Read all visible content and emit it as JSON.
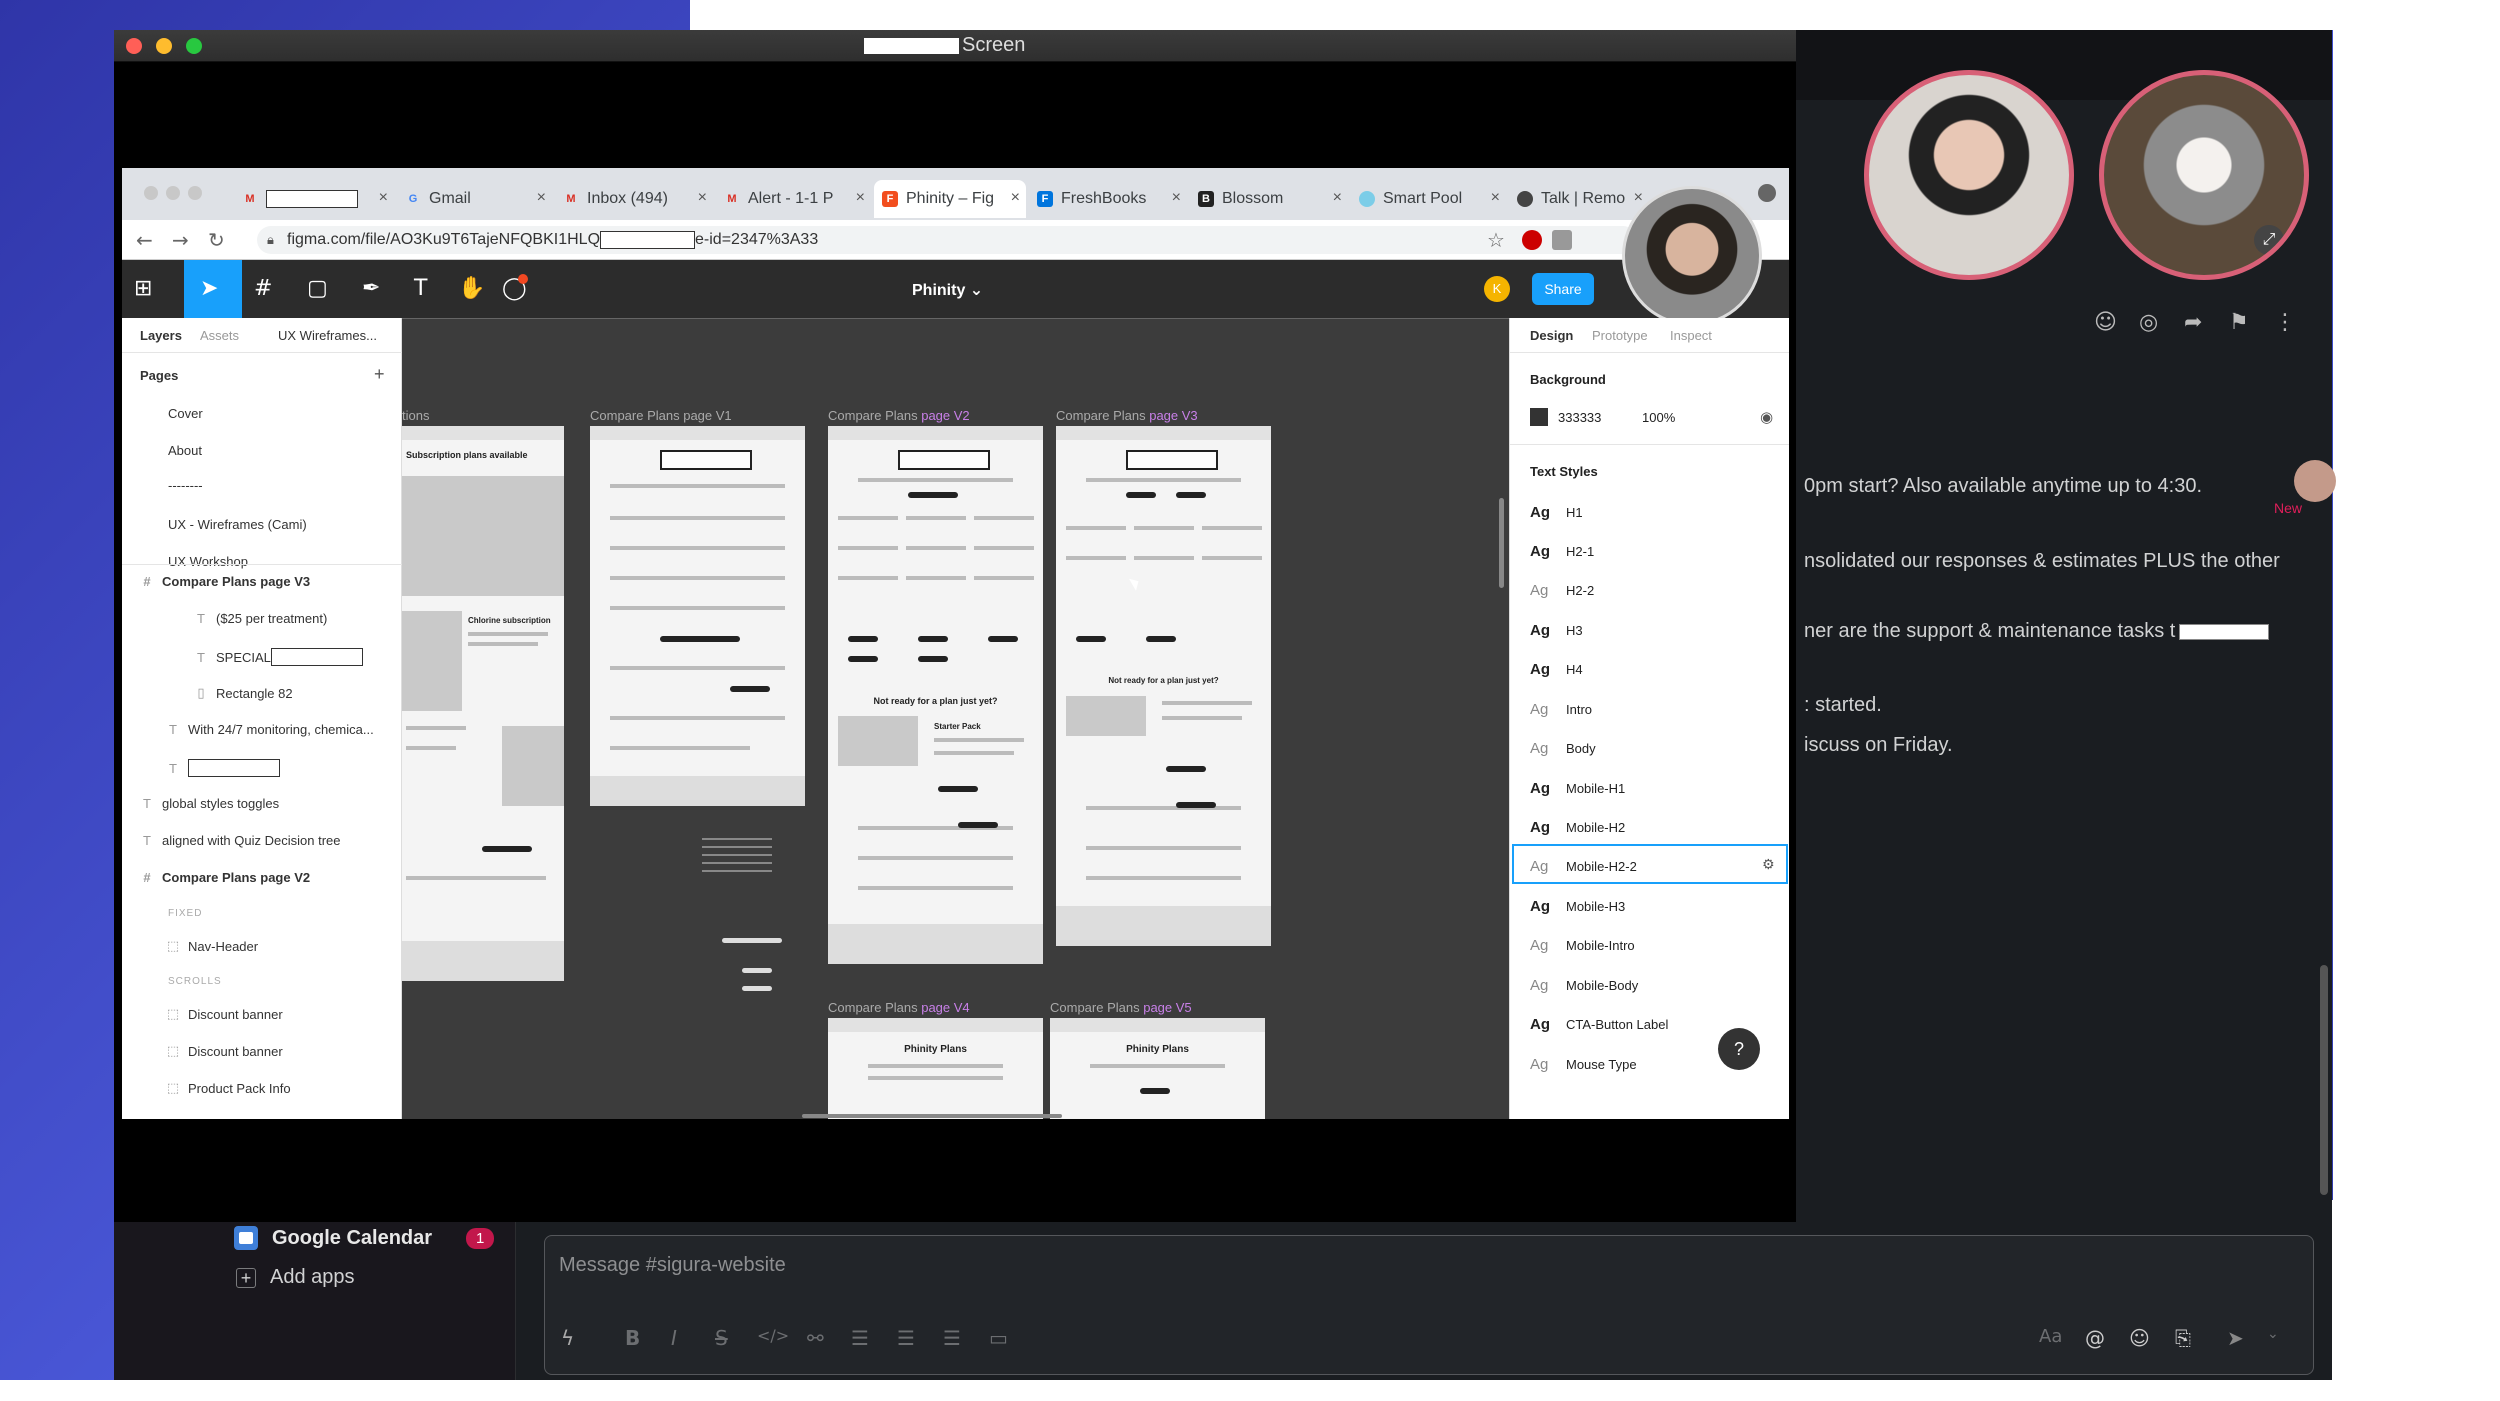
{
  "share_window": {
    "title": "Screen"
  },
  "browser": {
    "tabs": [
      {
        "label": "",
        "icon": "gmail-icon"
      },
      {
        "label": "Gmail",
        "icon": "google-icon"
      },
      {
        "label": "Inbox (494)",
        "icon": "gmail-icon"
      },
      {
        "label": "Alert - 1-1 P",
        "icon": "gmail-icon"
      },
      {
        "label": "Phinity – Fig",
        "icon": "figma-icon",
        "active": true
      },
      {
        "label": "FreshBooks",
        "icon": "freshbooks-icon"
      },
      {
        "label": "Blossom",
        "icon": "blossom-icon"
      },
      {
        "label": "Smart Pool",
        "icon": "smart-pool-icon"
      },
      {
        "label": "Talk | Remo",
        "icon": "globe-icon"
      }
    ],
    "url_prefix": "figma.com/file/AO3Ku9T6TajeNFQBKI1HLQ",
    "url_suffix": "e-id=2347%3A33"
  },
  "figma": {
    "file_name": "Phinity ⌄",
    "share_label": "Share",
    "user_initial": "K",
    "left_tabs": {
      "layers": "Layers",
      "assets": "Assets",
      "page": "UX Wireframes..."
    },
    "pages_heading": "Pages",
    "pages": [
      "Cover",
      "About",
      "--------",
      "UX - Wireframes (Cami)",
      "UX Workshop"
    ],
    "layers": [
      {
        "label": "Compare Plans page V3",
        "icon": "#",
        "bold": true
      },
      {
        "label": "($25 per treatment)",
        "icon": "T"
      },
      {
        "label": "SPECIAL",
        "icon": "T",
        "redacted": true
      },
      {
        "label": "Rectangle 82",
        "icon": "▯"
      },
      {
        "label": "With 24/7 monitoring, chemica...",
        "icon": "T"
      },
      {
        "label": "",
        "icon": "T",
        "redacted": true
      },
      {
        "label": "global styles toggles",
        "icon": "T"
      },
      {
        "label": "aligned with Quiz Decision tree",
        "icon": "T"
      },
      {
        "label": "Compare Plans page V2",
        "icon": "#",
        "bold": true
      },
      {
        "label": "FIXED",
        "caption": true
      },
      {
        "label": "Nav-Header",
        "icon": "⬚"
      },
      {
        "label": "SCROLLS",
        "caption": true
      },
      {
        "label": "Discount banner",
        "icon": "⬚"
      },
      {
        "label": "Discount banner",
        "icon": "⬚"
      },
      {
        "label": "Product Pack Info",
        "icon": "⬚"
      }
    ],
    "frames": {
      "v0": "tions",
      "v1": "Compare Plans page V1",
      "v2_a": "Compare Plans ",
      "v2_b": "page V2",
      "v3_a": "Compare Plans ",
      "v3_b": "page V3",
      "v4_a": "Compare Plans ",
      "v4_b": "page V4",
      "v5_a": "Compare Plans ",
      "v5_b": "page V5",
      "subscription": "Subscription plans available",
      "chlorine": "Chlorine subscription",
      "phinity_plans": "Phinity Plans",
      "not_ready": "Not ready for a plan just yet?",
      "starter": "Starter Pack"
    },
    "right_tabs": {
      "design": "Design",
      "prototype": "Prototype",
      "inspect": "Inspect"
    },
    "background": {
      "heading": "Background",
      "hex": "333333",
      "opacity": "100%",
      "color": "#333333"
    },
    "text_styles_heading": "Text Styles",
    "text_styles": [
      {
        "label": "H1",
        "bold": true
      },
      {
        "label": "H2-1",
        "bold": true
      },
      {
        "label": "H2-2",
        "bold": false
      },
      {
        "label": "H3",
        "bold": true
      },
      {
        "label": "H4",
        "bold": true
      },
      {
        "label": "Intro",
        "bold": false
      },
      {
        "label": "Body",
        "bold": false
      },
      {
        "label": "Mobile-H1",
        "bold": true
      },
      {
        "label": "Mobile-H2",
        "bold": true
      },
      {
        "label": "Mobile-H2-2",
        "bold": false,
        "selected": true
      },
      {
        "label": "Mobile-H3",
        "bold": true
      },
      {
        "label": "Mobile-Intro",
        "bold": false
      },
      {
        "label": "Mobile-Body",
        "bold": false
      },
      {
        "label": "CTA-Button Label",
        "bold": true
      },
      {
        "label": "Mouse Type",
        "bold": false
      }
    ],
    "help_label": "?"
  },
  "slack": {
    "messages": [
      "0pm start? Also available anytime up to 4:30.",
      "nsolidated our responses & estimates PLUS the other",
      "ner are the support & maintenance tasks t",
      ": started.",
      "iscuss on Friday."
    ],
    "new_label": "New",
    "sidebar": {
      "calendar": "Google Calendar",
      "calendar_badge": "1",
      "add_apps": "Add apps"
    },
    "composer_placeholder": "Message #sigura-website"
  }
}
